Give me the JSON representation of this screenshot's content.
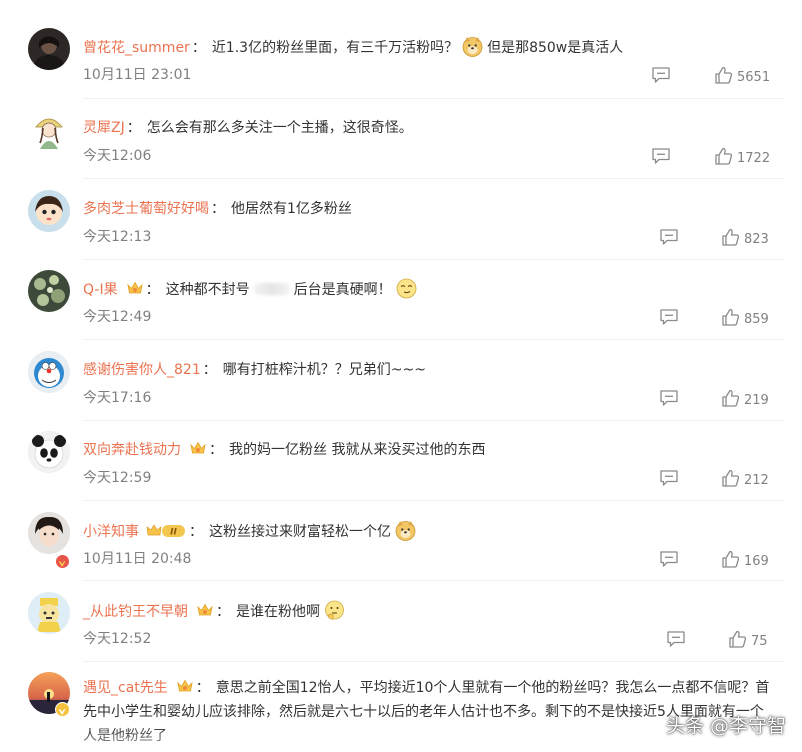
{
  "comments": [
    {
      "user": "曾花花_summer",
      "text_a": "近1.3亿的粉丝里面，有三千万活粉吗？",
      "text_b": "但是那850w是真活人",
      "time": "10月11日 23:01",
      "likes": "5651"
    },
    {
      "user": "灵犀ZJ",
      "text_a": "怎么会有那么多关注一个主播，这很奇怪。",
      "time": "今天12:06",
      "likes": "1722"
    },
    {
      "user": "多肉芝士葡萄好好喝",
      "text_a": "他居然有1亿多粉丝",
      "time": "今天12:13",
      "likes": "823"
    },
    {
      "user": "Q-I果",
      "text_a": "这种都不封号",
      "text_b": "后台是真硬啊！",
      "time": "今天12:49",
      "likes": "859"
    },
    {
      "user": "感谢伤害你人_821",
      "text_a": "哪有打桩榨汁机？？兄弟们~~~",
      "time": "今天17:16",
      "likes": "219"
    },
    {
      "user": "双向奔赴钱动力",
      "text_a": "我的妈一亿粉丝 我就从来没买过他的东西",
      "time": "今天12:59",
      "likes": "212"
    },
    {
      "user": "小洋知事",
      "text_a": "这粉丝接过来财富轻松一个亿",
      "time": "10月11日 20:48",
      "likes": "169"
    },
    {
      "user": "_从此钓王不早朝",
      "text_a": "是谁在粉他啊",
      "time": "今天12:52",
      "likes": "75"
    },
    {
      "user": "遇见_cat先生",
      "text_a": "意思之前全国12怡人，平均接近10个人里就有一个他的粉丝吗？我怎么一点都不信呢？首先中小学生和婴幼儿应该排除，然后就是六七十以后的老年人估计也不多。剩下的不是快接近5人里面就有一个人是他粉丝了"
    }
  ],
  "watermark": "头条 @李守智",
  "colors": {
    "username": "#eb7350",
    "meta": "#808080",
    "text": "#333333"
  }
}
